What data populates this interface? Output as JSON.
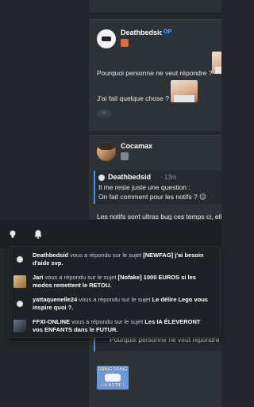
{
  "posts": [
    {
      "author": "Deathbedsid",
      "op_badge": "OP",
      "lines": [
        "Pourquoi personne ne veut répondre ?",
        "J'ai fait quelque chose ?"
      ],
      "reaction_icon": "emoji-add-icon"
    },
    {
      "author": "Cocamax",
      "quote": {
        "author": "Deathbedsid",
        "time": "· 13m",
        "lines": [
          "Il me reste juste une question :",
          "On fait comment pour les notifs ? 😐"
        ]
      },
      "lines": [
        "Les notifs sont ultras bug ces temps ci, ell"
      ]
    },
    {
      "quote_line": "Pourquoi personne ne veut répondre ?",
      "gif": {
        "top_text": "DRING DRING !",
        "bottom_text": "LA NOTIF !"
      }
    }
  ],
  "nav": {
    "lightbulb_icon": "lightbulb-icon",
    "bell_icon": "bell-icon"
  },
  "notifications": [
    {
      "user": "Deathbedsid",
      "action": " vous a répondu sur le sujet ",
      "topic": "[NEWFAG] j'ai besoin d'aide svp."
    },
    {
      "user": "Jari",
      "action": " vous a répondu sur le sujet ",
      "topic": "[Nofake] 1000 EUROS si les modos remettent le RETOU."
    },
    {
      "user": "yattaquenelle24",
      "action": " vous a répondu sur le sujet ",
      "topic": "Le délire Lego vous inspire quoi ?."
    },
    {
      "user": "FFXI-ONLINE",
      "action": " vous a répondu sur le sujet ",
      "topic": "Les IA ÉLEVERONT vos ENFANTS dans le FUTUR."
    }
  ],
  "colors": {
    "accent": "#4f8fe0",
    "background": "#23272b",
    "card": "#2d3237",
    "dropdown": "#1e2125"
  }
}
